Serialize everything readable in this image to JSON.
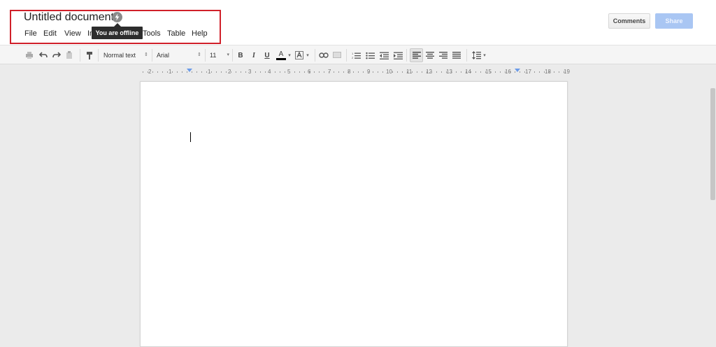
{
  "document": {
    "title": "Untitled document"
  },
  "status": {
    "tooltip": "You are offline",
    "icon": "offline-lightning-icon"
  },
  "menu": {
    "items": [
      {
        "id": "file",
        "label": "File"
      },
      {
        "id": "edit",
        "label": "Edit"
      },
      {
        "id": "view",
        "label": "View"
      },
      {
        "id": "insert",
        "label": "In"
      },
      {
        "id": "tools",
        "label": "Tools"
      },
      {
        "id": "table",
        "label": "Table"
      },
      {
        "id": "help",
        "label": "Help"
      }
    ]
  },
  "header_buttons": {
    "comments": "Comments",
    "share": "Share"
  },
  "toolbar": {
    "style": "Normal text",
    "font": "Arial",
    "font_size": "11",
    "bold": "B",
    "italic": "I",
    "underline": "U",
    "text_color": "A",
    "icons": [
      "print-icon",
      "undo-icon",
      "redo-icon",
      "paste-icon",
      "paint-format-icon",
      "link-icon",
      "comment-icon",
      "numbered-list-icon",
      "bulleted-list-icon",
      "decrease-indent-icon",
      "increase-indent-icon",
      "align-left-icon",
      "align-center-icon",
      "align-right-icon",
      "justify-icon",
      "line-spacing-icon"
    ]
  },
  "ruler": {
    "labels": [
      "2",
      "1",
      "1",
      "2",
      "3",
      "4",
      "5",
      "6",
      "7",
      "8",
      "9",
      "10",
      "11",
      "12",
      "13",
      "14",
      "15",
      "16",
      "17",
      "18",
      "19"
    ]
  },
  "colors": {
    "highlight_border": "#d0202a",
    "share_button": "#a9c6f3",
    "tooltip_bg": "#2d2d2d"
  }
}
